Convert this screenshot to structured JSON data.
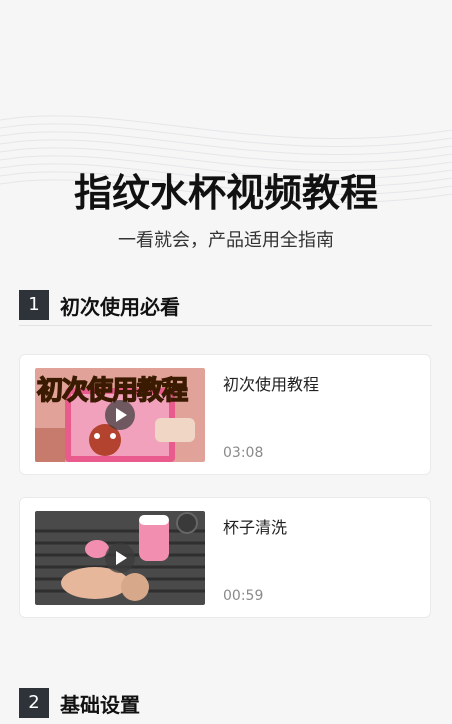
{
  "header": {
    "title": "指纹水杯视频教程",
    "subtitle": "一看就会，产品适用全指南"
  },
  "sections": [
    {
      "number": "1",
      "title": "初次使用必看",
      "videos": [
        {
          "title": "初次使用教程",
          "duration": "03:08",
          "thumb_caption": "初次使用教程"
        },
        {
          "title": "杯子清洗",
          "duration": "00:59"
        }
      ]
    },
    {
      "number": "2",
      "title": "基础设置"
    }
  ],
  "colors": {
    "background": "#f6f6f7",
    "section_badge": "#2d3338",
    "card": "#ffffff",
    "duration_text": "#8a8a8a"
  },
  "icons": [
    "play-icon"
  ]
}
